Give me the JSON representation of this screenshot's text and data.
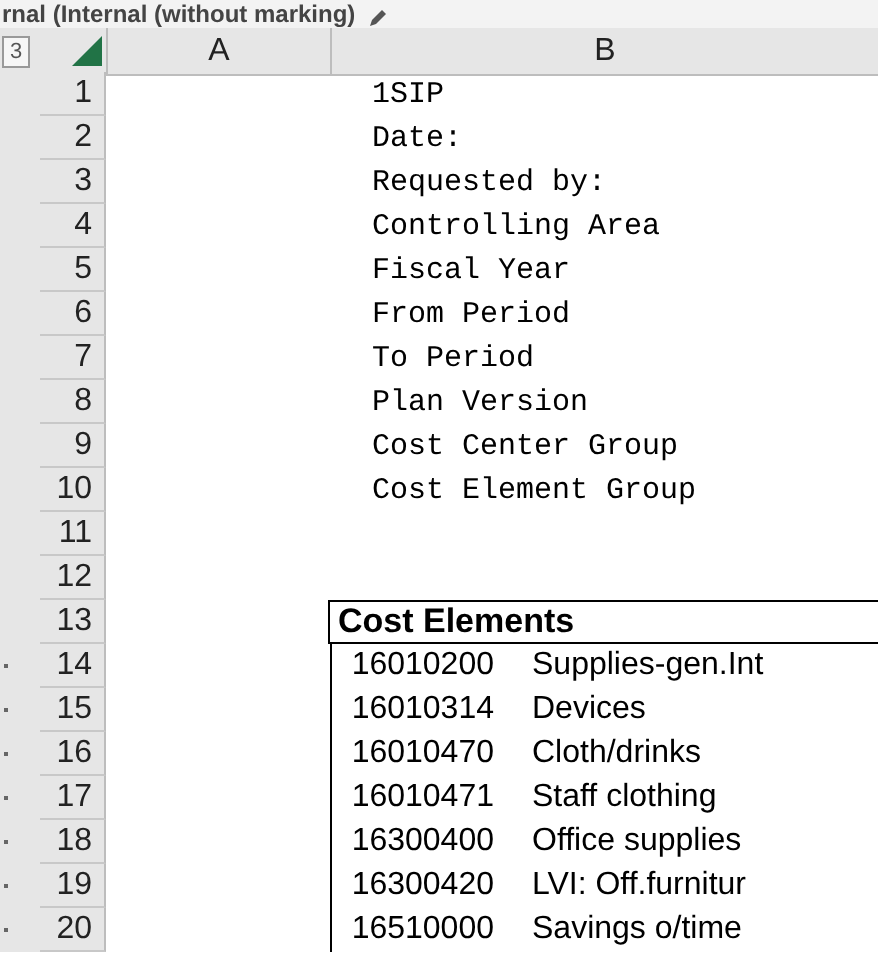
{
  "title_bar": {
    "title": "rnal (Internal (without marking)"
  },
  "outline_level": "3",
  "columns": [
    "A",
    "B"
  ],
  "rows": [
    {
      "number": "1",
      "kind": "text",
      "text": "1SIP"
    },
    {
      "number": "2",
      "kind": "text",
      "text": "Date:"
    },
    {
      "number": "3",
      "kind": "text",
      "text": "Requested by:"
    },
    {
      "number": "4",
      "kind": "text",
      "text": "Controlling Area"
    },
    {
      "number": "5",
      "kind": "text",
      "text": "Fiscal Year"
    },
    {
      "number": "6",
      "kind": "text",
      "text": "From Period"
    },
    {
      "number": "7",
      "kind": "text",
      "text": "To Period"
    },
    {
      "number": "8",
      "kind": "text",
      "text": "Plan Version"
    },
    {
      "number": "9",
      "kind": "text",
      "text": "Cost Center Group"
    },
    {
      "number": "10",
      "kind": "text",
      "text": "Cost Element Group"
    },
    {
      "number": "11",
      "kind": "empty"
    },
    {
      "number": "12",
      "kind": "empty"
    },
    {
      "number": "13",
      "kind": "heading",
      "text": "Cost Elements"
    },
    {
      "number": "14",
      "kind": "item",
      "code": "16010200",
      "name": "Supplies-gen.Int"
    },
    {
      "number": "15",
      "kind": "item",
      "code": "16010314",
      "name": "Devices"
    },
    {
      "number": "16",
      "kind": "item",
      "code": "16010470",
      "name": "Cloth/drinks"
    },
    {
      "number": "17",
      "kind": "item",
      "code": "16010471",
      "name": "Staff clothing"
    },
    {
      "number": "18",
      "kind": "item",
      "code": "16300400",
      "name": "Office supplies"
    },
    {
      "number": "19",
      "kind": "item",
      "code": "16300420",
      "name": "LVI: Off.furnitur"
    },
    {
      "number": "20",
      "kind": "item",
      "code": "16510000",
      "name": "Savings o/time"
    }
  ]
}
